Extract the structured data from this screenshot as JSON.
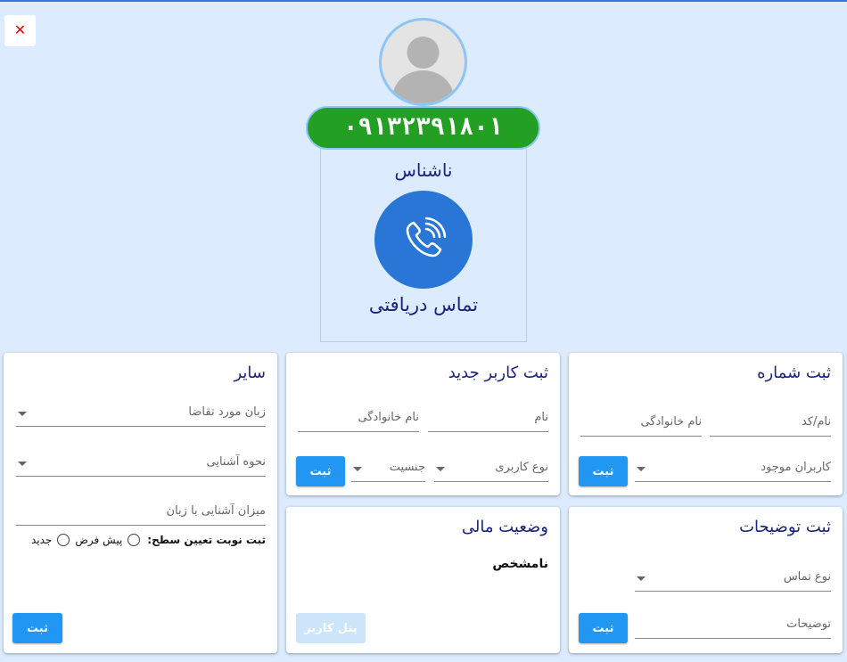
{
  "close_label": "✕",
  "caller": {
    "phone": "۰۹۱۳۲۳۹۱۸۰۱",
    "name": "ناشناس",
    "call_type": "تماس دریافتی"
  },
  "register_number": {
    "title": "ثبت شماره",
    "name_code": "نام/کد",
    "family_name": "نام خانوادگی",
    "existing_users": "کاربران موجود",
    "submit": "ثبت"
  },
  "new_user": {
    "title": "ثبت کاربر جدید",
    "first_name": "نام",
    "family_name": "نام خانوادگی",
    "user_type": "نوع کاربری",
    "gender": "جنسیت",
    "submit": "ثبت"
  },
  "other": {
    "title": "سایر",
    "requested_language": "زبان مورد تقاضا",
    "acquaintance_method": "نحوه آشنایی",
    "language_familiarity": "میزان آشنایی با زبان",
    "level_test_label": "ثبت نوبت تعیین سطح:",
    "option_default": "پیش فرض",
    "option_new": "جدید",
    "submit": "ثبت"
  },
  "notes": {
    "title": "ثبت توضیحات",
    "call_kind": "نوع تماس",
    "description": "توضیحات",
    "submit": "ثبت"
  },
  "financial": {
    "title": "وضعیت مالی",
    "status": "نامشخص",
    "user_panel": "پنل کاربر"
  },
  "colors": {
    "background": "#dcebfd",
    "accent": "#2196f3",
    "phone_green": "#23a024",
    "title_navy": "#1a237e"
  }
}
